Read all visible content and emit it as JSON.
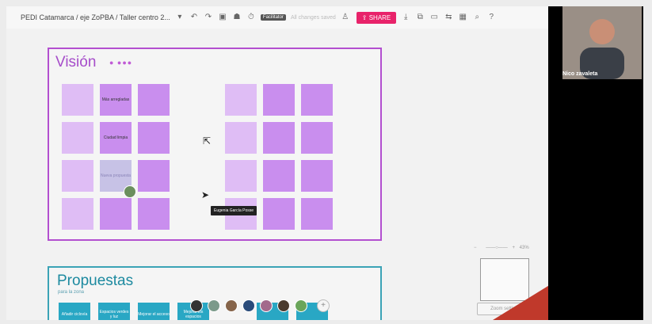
{
  "topbar": {
    "breadcrumb": "PEDI Catamarca / eje ZoPBA / Taller centro 2...",
    "facilitator_badge": "Facilitator",
    "saved_status": "All changes saved",
    "share_label": "SHARE",
    "share_icon": "upload-icon",
    "share_color": "#e8236a",
    "icons": [
      "chevron-down-icon",
      "undo-icon",
      "redo-icon",
      "frame-icon",
      "users-icon",
      "timer-icon",
      "user-icon",
      "download-icon",
      "copy-icon",
      "chat-icon",
      "translate-icon",
      "grid-icon",
      "zoom-icon",
      "help-icon"
    ]
  },
  "board": {
    "vision": {
      "title": "Visión",
      "dots": "● ●●●",
      "accent": "#b34fd0",
      "notes": [
        {
          "text": ""
        },
        {
          "text": "Más arregladas"
        },
        {
          "text": ""
        },
        {
          "text": ""
        },
        {
          "text": "Ciudad limpia"
        },
        {
          "text": ""
        },
        {
          "text": ""
        },
        {
          "text": "Nueva propuesta"
        },
        {
          "text": ""
        },
        {
          "text": ""
        },
        {
          "text": ""
        },
        {
          "text": ""
        }
      ],
      "notes_right": [
        {
          "text": ""
        },
        {
          "text": ""
        },
        {
          "text": ""
        },
        {
          "text": ""
        },
        {
          "text": ""
        },
        {
          "text": ""
        },
        {
          "text": ""
        },
        {
          "text": ""
        },
        {
          "text": ""
        },
        {
          "text": ""
        },
        {
          "text": ""
        },
        {
          "text": ""
        }
      ]
    },
    "propuestas": {
      "title": "Propuestas",
      "subtitle": "para la zona",
      "accent": "#3ba3b6",
      "notes": [
        {
          "text": "Añadir ciclovía"
        },
        {
          "text": "Espacios verdes y luz"
        },
        {
          "text": "Mejorar el acceso"
        },
        {
          "text": "Mejorar los espacios"
        },
        {
          "text": ""
        },
        {
          "text": ""
        }
      ]
    },
    "cursor_tooltip": "Eugenia García Posse",
    "participants": [
      "#333",
      "#7b9",
      "#864",
      "#246",
      "#a36",
      "#432",
      "#6a5"
    ],
    "add_participant": "+"
  },
  "minimap": {
    "zoom": "43%",
    "fit_label": "Zoom settings"
  },
  "video": {
    "participant_name": "Nico zavaleta"
  }
}
